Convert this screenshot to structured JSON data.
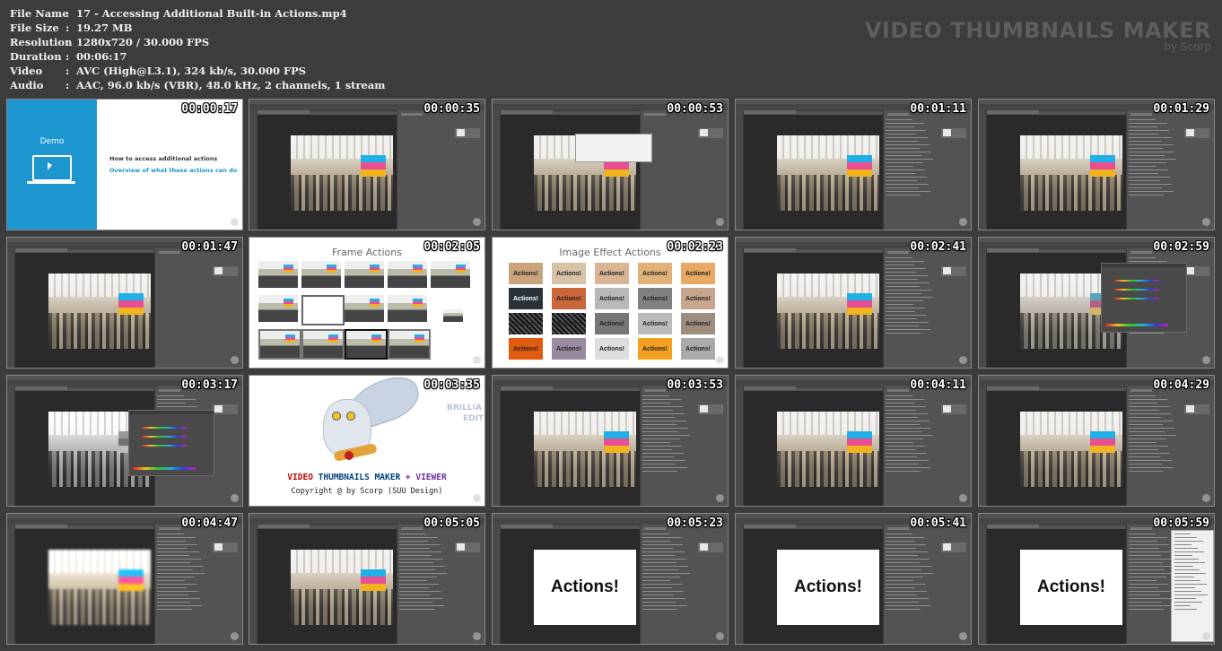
{
  "info": {
    "rows": [
      {
        "label": "File Name",
        "value": "17 - Accessing Additional Built-in Actions.mp4"
      },
      {
        "label": "File Size",
        "value": "19.27 MB"
      },
      {
        "label": "Resolution",
        "value": "1280x720 / 30.000 FPS"
      },
      {
        "label": "Duration",
        "value": "00:06:17"
      },
      {
        "label": "Video",
        "value": "AVC (High@L3.1), 324 kb/s, 30.000 FPS"
      },
      {
        "label": "Audio",
        "value": "AAC, 96.0 kb/s (VBR), 48.0 kHz, 2 channels, 1 stream"
      }
    ],
    "separator": ":"
  },
  "brand": {
    "title": "VIDEO THUMBNAILS MAKER",
    "subtitle": "by Scorp"
  },
  "demo": {
    "label": "Demo",
    "line1": "How to access additional actions",
    "line2": "Overview of what these actions can do"
  },
  "frame_slide": {
    "title": "Frame Actions"
  },
  "effect_slide": {
    "title": "Image Effect Actions",
    "item_label": "Actions!"
  },
  "actions_card": {
    "label": "Actions!"
  },
  "splash": {
    "brilliant_line1": "BRILLIA",
    "brilliant_line2": "EDIT",
    "title_part1": "VIDEO",
    "title_part2": "THUMBNAILS MAKER",
    "title_part3": "+ VIEWER",
    "copyright": "Copyright @ by Scorp (SUU Design)"
  },
  "thumbnails": [
    {
      "time": "00:00:17",
      "kind": "demo"
    },
    {
      "time": "00:00:35",
      "kind": "ps-photo"
    },
    {
      "time": "00:00:53",
      "kind": "ps-alert"
    },
    {
      "time": "00:01:11",
      "kind": "ps-photo-actions"
    },
    {
      "time": "00:01:29",
      "kind": "ps-photo-actions"
    },
    {
      "time": "00:01:47",
      "kind": "ps-photo"
    },
    {
      "time": "00:02:05",
      "kind": "frame"
    },
    {
      "time": "00:02:23",
      "kind": "effect"
    },
    {
      "time": "00:02:41",
      "kind": "ps-photo-actions"
    },
    {
      "time": "00:02:59",
      "kind": "ps-dialog"
    },
    {
      "time": "00:03:17",
      "kind": "ps-dialog-bw"
    },
    {
      "time": "00:03:35",
      "kind": "splash"
    },
    {
      "time": "00:03:53",
      "kind": "ps-photo-actions"
    },
    {
      "time": "00:04:11",
      "kind": "ps-photo-actions"
    },
    {
      "time": "00:04:29",
      "kind": "ps-photo-actions"
    },
    {
      "time": "00:04:47",
      "kind": "ps-photo-blur"
    },
    {
      "time": "00:05:05",
      "kind": "ps-photo-actions"
    },
    {
      "time": "00:05:23",
      "kind": "ps-actions-card"
    },
    {
      "time": "00:05:41",
      "kind": "ps-actions-card"
    },
    {
      "time": "00:05:59",
      "kind": "ps-actions-menu"
    }
  ]
}
